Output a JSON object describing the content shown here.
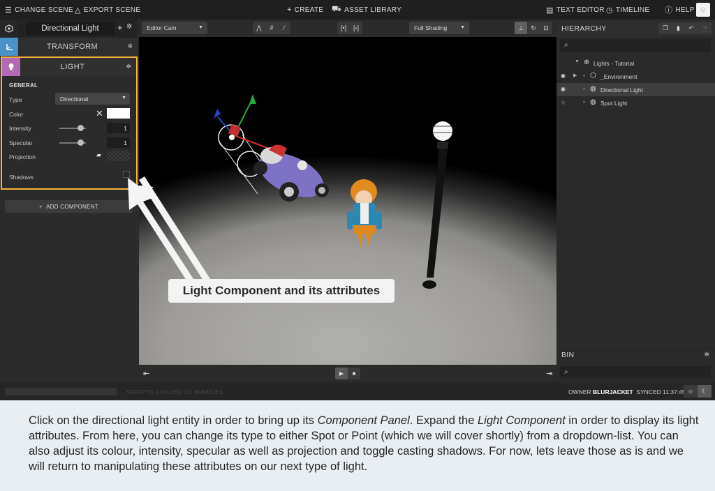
{
  "topbar": {
    "change_scene": "CHANGE SCENE",
    "export_scene": "EXPORT SCENE",
    "create": "CREATE",
    "asset_library": "ASSET LIBRARY",
    "text_editor": "TEXT EDITOR",
    "timeline": "TIMELINE",
    "help": "HELP"
  },
  "entity": {
    "name": "Directional Light"
  },
  "components": {
    "transform": "TRANSFORM",
    "light": {
      "title": "LIGHT",
      "section": "GENERAL",
      "type_label": "Type",
      "type_value": "Directional",
      "color_label": "Color",
      "color_value": "#ffffff",
      "intensity_label": "Intensity",
      "intensity_value": "1",
      "intensity_slider": 0.8,
      "specular_label": "Specular",
      "specular_value": "1",
      "specular_slider": 0.8,
      "projection_label": "Projection",
      "shadows_label": "Shadows",
      "shadows_checked": false
    },
    "add_component": "ADD COMPONENT"
  },
  "viewport": {
    "camera": "Editor Cam",
    "shading": "Full Shading"
  },
  "hierarchy": {
    "title": "HIERARCHY",
    "items": [
      {
        "label": "Lights - Tutorial"
      },
      {
        "label": "_Environment"
      },
      {
        "label": "Directional Light"
      },
      {
        "label": "Spot Light"
      }
    ]
  },
  "bin": {
    "title": "BIN"
  },
  "status": {
    "message": "SCRIPTS: LOADED 0/1 BUNDLES",
    "owner_label": "OWNER",
    "owner_name": "BLURJACKET",
    "synced": "SYNCED 11:37:45"
  },
  "callout": "Light Component and its attributes",
  "caption": {
    "part1": "Click on the directional light entity in order to bring up its ",
    "em1": "Component Panel",
    "part2": ". Expand the ",
    "em2": "Light Component",
    "part3": " in order to display its light attributes. From here, you can change its type to either Spot or Point (which we will cover shortly) from a dropdown-list. You can also adjust its colour, intensity, specular as well as projection and toggle casting shadows. For now, lets leave those as is and we will return to manipulating these attributes on our next type of light."
  },
  "colors": {
    "highlight": "#f5b33d",
    "transform_accent": "#4a90c9",
    "light_accent": "#b46ab2"
  }
}
